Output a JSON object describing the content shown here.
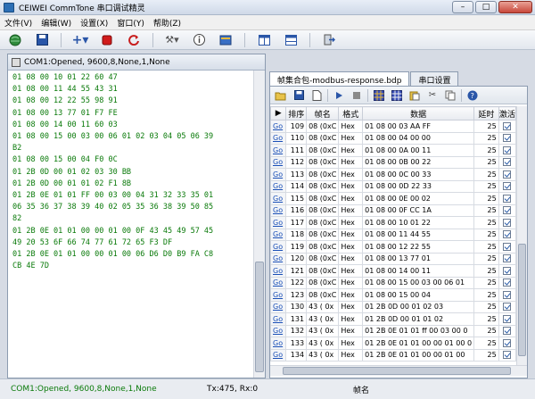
{
  "window": {
    "title": "CEIWEI CommTone 串口调试精灵",
    "min": "–",
    "max": "□",
    "close": "✕"
  },
  "menu": [
    "文件(V)",
    "编辑(W)",
    "设置(X)",
    "窗口(Y)",
    "帮助(Z)"
  ],
  "left_pane": {
    "header": "COM1:Opened, 9600,8,None,1,None",
    "lines": [
      "01 08 00 10 01 22 60 47",
      "01 08 00 11 44 55 43 31",
      "01 08 00 12 22 55 98 91",
      "01 08 00 13 77 01 F7 FE",
      "01 08 00 14 00 11 60 03",
      "01 08 00 15 00 03 00 06 01 02 03 04 05 06 39",
      "B2",
      "01 08 00 15 00 04 F0 0C",
      "01 2B 0D 00 01 02 03 30 BB",
      "01 2B 0D 00 01 01 02 F1 8B",
      "01 2B 0E 01 01 FF 00 03 00 04 31 32 33 35 01",
      "06 35 36 37 38 39 40 02 05 35 36 38 39 50 85",
      "82",
      "01 2B 0E 01 01 00 00 01 00 0F 43 45 49 57 45",
      "49 20 53 6F 66 74 77 61 72 65 F3 DF",
      "01 2B 0E 01 01 00 00 01 00 06 D6 D0 B9 FA C8",
      "CB 4E 7D"
    ]
  },
  "tabs": [
    "帧集合包-modbus-response.bdp",
    "串口设置"
  ],
  "grid": {
    "headers": [
      "",
      "排序",
      "帧名",
      "格式",
      "数据",
      "延时",
      "激活"
    ],
    "rows": [
      {
        "go": "Go",
        "seq": "109",
        "name": "08 (0xC",
        "fmt": "Hex",
        "data": "01 08 00 03 AA FF",
        "delay": "25"
      },
      {
        "go": "Go",
        "seq": "110",
        "name": "08 (0xC",
        "fmt": "Hex",
        "data": "01 08 00 04 00 00",
        "delay": "25"
      },
      {
        "go": "Go",
        "seq": "111",
        "name": "08 (0xC",
        "fmt": "Hex",
        "data": "01 08 00 0A 00 11",
        "delay": "25"
      },
      {
        "go": "Go",
        "seq": "112",
        "name": "08 (0xC",
        "fmt": "Hex",
        "data": "01 08 00 0B 00 22",
        "delay": "25"
      },
      {
        "go": "Go",
        "seq": "113",
        "name": "08 (0xC",
        "fmt": "Hex",
        "data": "01 08 00 0C 00 33",
        "delay": "25"
      },
      {
        "go": "Go",
        "seq": "114",
        "name": "08 (0xC",
        "fmt": "Hex",
        "data": "01 08 00 0D 22 33",
        "delay": "25"
      },
      {
        "go": "Go",
        "seq": "115",
        "name": "08 (0xC",
        "fmt": "Hex",
        "data": "01 08 00 0E 00 02",
        "delay": "25"
      },
      {
        "go": "Go",
        "seq": "116",
        "name": "08 (0xC",
        "fmt": "Hex",
        "data": "01 08 00 0F CC 1A",
        "delay": "25"
      },
      {
        "go": "Go",
        "seq": "117",
        "name": "08 (0xC",
        "fmt": "Hex",
        "data": "01 08 00 10 01 22",
        "delay": "25"
      },
      {
        "go": "Go",
        "seq": "118",
        "name": "08 (0xC",
        "fmt": "Hex",
        "data": "01 08 00 11 44 55",
        "delay": "25"
      },
      {
        "go": "Go",
        "seq": "119",
        "name": "08 (0xC",
        "fmt": "Hex",
        "data": "01 08 00 12 22 55",
        "delay": "25"
      },
      {
        "go": "Go",
        "seq": "120",
        "name": "08 (0xC",
        "fmt": "Hex",
        "data": "01 08 00 13 77 01",
        "delay": "25"
      },
      {
        "go": "Go",
        "seq": "121",
        "name": "08 (0xC",
        "fmt": "Hex",
        "data": "01 08 00 14 00 11",
        "delay": "25"
      },
      {
        "go": "Go",
        "seq": "122",
        "name": "08 (0xC",
        "fmt": "Hex",
        "data": "01 08 00 15 00 03 00 06 01",
        "delay": "25"
      },
      {
        "go": "Go",
        "seq": "123",
        "name": "08 (0xC",
        "fmt": "Hex",
        "data": "01 08 00 15 00 04",
        "delay": "25"
      },
      {
        "go": "Go",
        "seq": "130",
        "name": "43 ( 0x",
        "fmt": "Hex",
        "data": "01 2B 0D 00 01 02 03",
        "delay": "25"
      },
      {
        "go": "Go",
        "seq": "131",
        "name": "43 ( 0x",
        "fmt": "Hex",
        "data": "01 2B 0D 00 01 01 02",
        "delay": "25"
      },
      {
        "go": "Go",
        "seq": "132",
        "name": "43 ( 0x",
        "fmt": "Hex",
        "data": "01 2B 0E 01 01 ff 00 03 00 0",
        "delay": "25"
      },
      {
        "go": "Go",
        "seq": "133",
        "name": "43 ( 0x",
        "fmt": "Hex",
        "data": "01 2B 0E 01 01 00 00 01 00 0",
        "delay": "25"
      },
      {
        "go": "Go",
        "seq": "134",
        "name": "43 ( 0x",
        "fmt": "Hex",
        "data": "01 2B 0E 01 01 00 00 01 00",
        "delay": "25"
      }
    ]
  },
  "status": {
    "port": "COM1:Opened, 9600,8,None,1,None",
    "counter": "Tx:475, Rx:0",
    "frame_label": "帧名"
  }
}
